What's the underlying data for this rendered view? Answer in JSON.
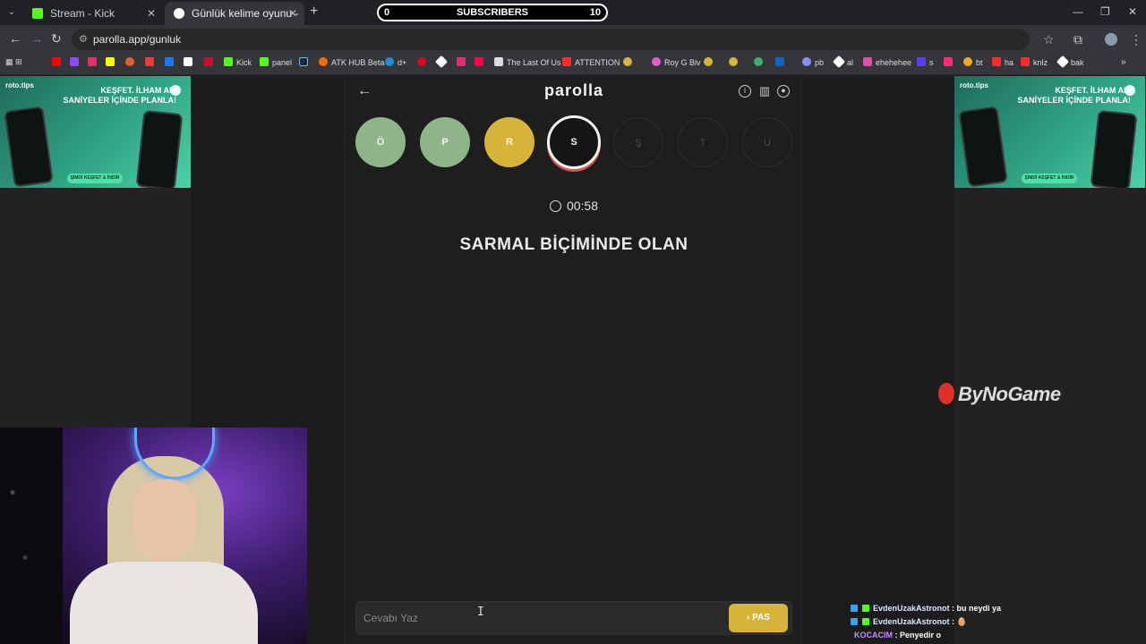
{
  "browser": {
    "tabs": [
      {
        "title": "Stream - Kick Dashboard",
        "favicon_color": "#53fc18",
        "active": false
      },
      {
        "title": "Günlük kelime oyunu - par",
        "favicon_color": "#ffffff",
        "active": true
      }
    ],
    "url": "parolla.app/gunluk"
  },
  "subscribers_bar": {
    "current": "0",
    "label": "SUBSCRIBERS",
    "goal": "10"
  },
  "bookmarks": [
    {
      "label": "Kick",
      "color": "#53fc18"
    },
    {
      "label": "panel",
      "color": "#53fc18"
    },
    {
      "label": "ATK HUB Beta",
      "color": "#ff6a00"
    },
    {
      "label": "d+",
      "color": "#1a8fd6"
    },
    {
      "label": "The Last Of Us",
      "color": "#ffffff"
    },
    {
      "label": "ATTENTION",
      "color": "#ff2a2a"
    },
    {
      "label": "Roy G Biv",
      "color": "#e35bd0"
    },
    {
      "label": "pb",
      "color": "#8b8bff"
    },
    {
      "label": "al",
      "color": "#ffffff"
    },
    {
      "label": "ehehehee",
      "color": "#e14fae"
    },
    {
      "label": "s",
      "color": "#5a3cff"
    },
    {
      "label": "bt",
      "color": "#f5a623"
    },
    {
      "label": "ha",
      "color": "#ff2a2a"
    },
    {
      "label": "knlz",
      "color": "#ff2a2a"
    },
    {
      "label": "bak",
      "color": "#ffffff"
    }
  ],
  "ad": {
    "brand": "roto.tips",
    "headline_line1": "KEŞFET. İLHAM AL.",
    "headline_line2": "SANİYELER İÇİNDE PLANLA!",
    "cta": "ŞİMDİ KEŞFET & İNDİR"
  },
  "sponsor_logo": "ByNoGame",
  "game": {
    "title": "parolla",
    "letters": [
      {
        "char": "Ö",
        "state": "correct"
      },
      {
        "char": "P",
        "state": "correct"
      },
      {
        "char": "R",
        "state": "yellow"
      },
      {
        "char": "S",
        "state": "current"
      },
      {
        "char": "Ş",
        "state": "pending"
      },
      {
        "char": "T",
        "state": "pending"
      },
      {
        "char": "U",
        "state": "pending"
      }
    ],
    "timer": "00:58",
    "clue": "SARMAL BİÇİMİNDE OLAN",
    "answer_placeholder": "Cevabı Yaz",
    "pass_button": "PAS",
    "colors": {
      "correct": "#8fb48a",
      "yellow": "#d7b33a",
      "current_ring": "#d9534f"
    }
  },
  "chat": [
    {
      "user": "EvdenUzakAstronot",
      "text": "bu neydi ya",
      "user_color": "#dfe7ff"
    },
    {
      "user": "EvdenUzakAstronot",
      "text": "🥚",
      "user_color": "#dfe7ff"
    },
    {
      "user": "KOCACIM",
      "text": "Penyedir o",
      "user_color": "#c58cff"
    }
  ]
}
